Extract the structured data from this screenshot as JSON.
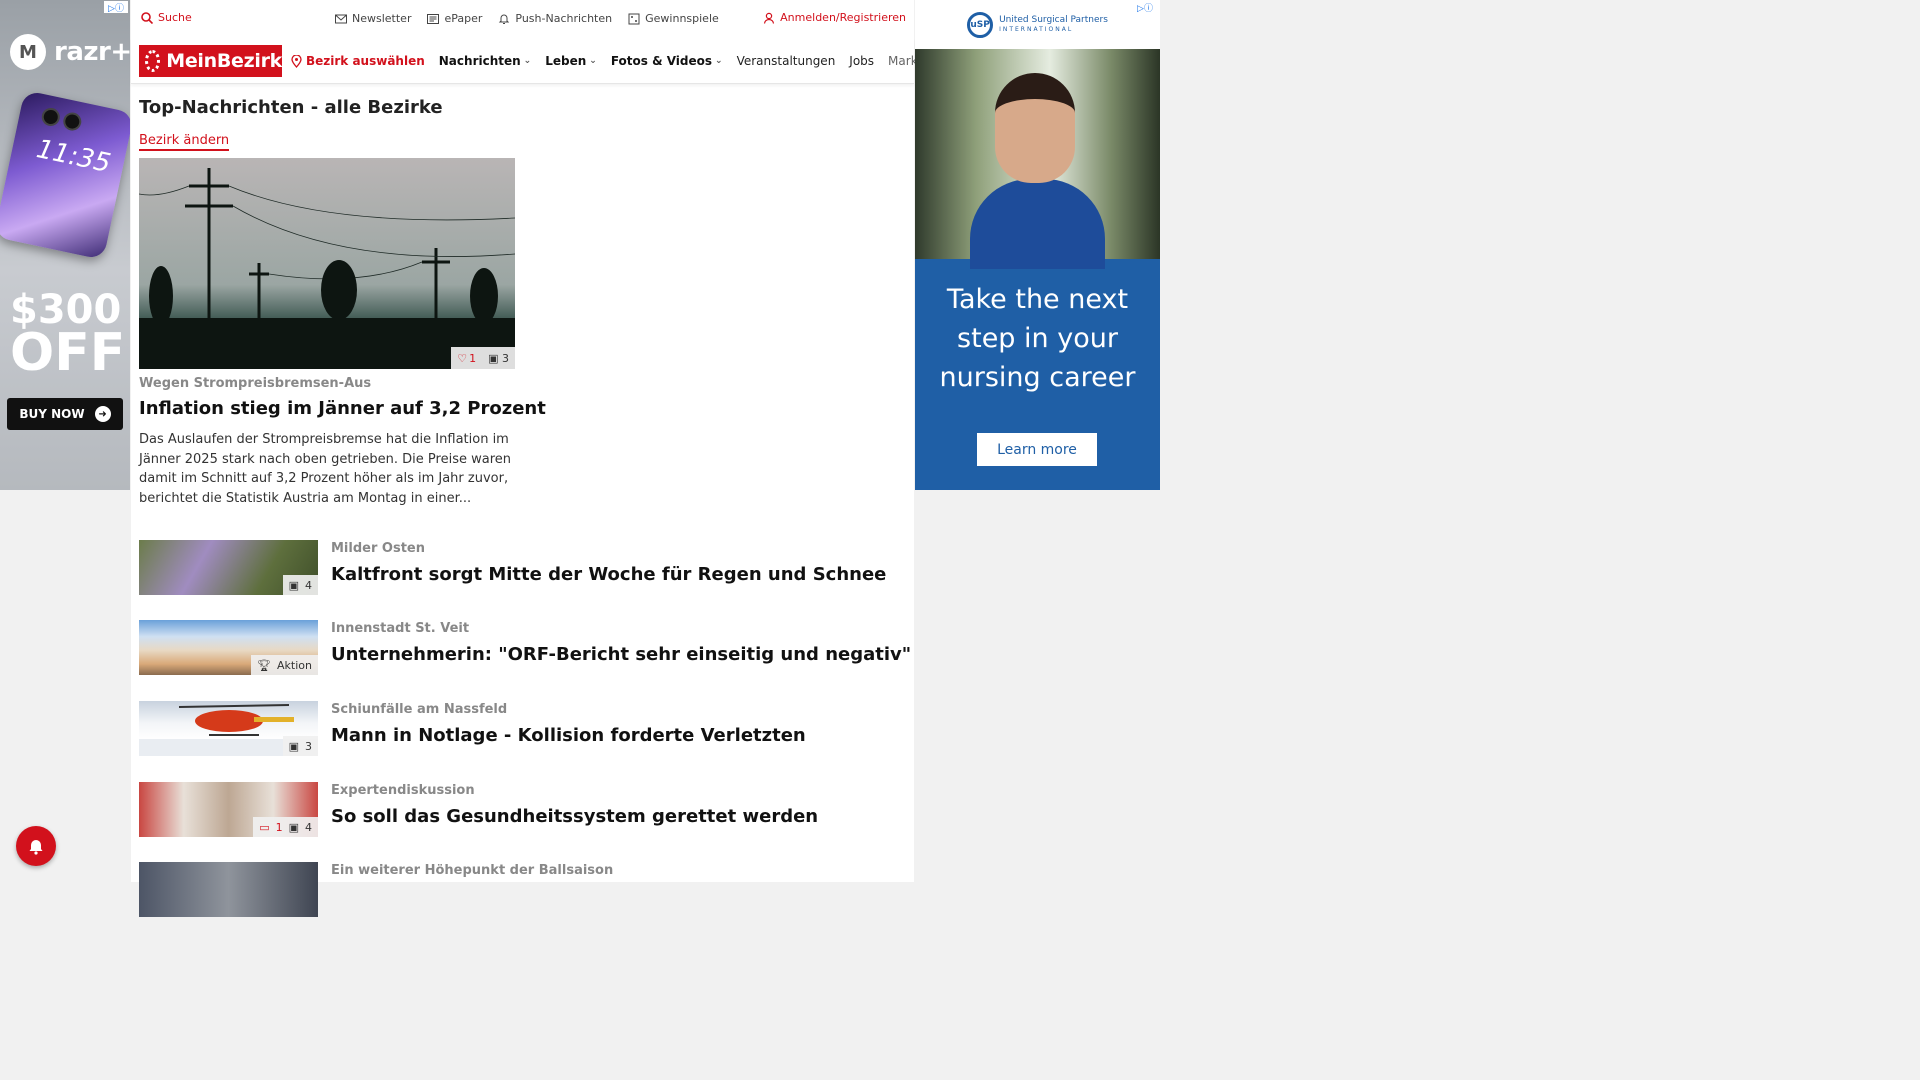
{
  "left_ad": {
    "brand": "razr+",
    "phone_time": "11:35",
    "price": "$300",
    "off": "OFF",
    "cta": "BUY NOW"
  },
  "topbar": {
    "search": "Suche",
    "links": [
      "Newsletter",
      "ePaper",
      "Push-Nachrichten",
      "Gewinnspiele"
    ],
    "login": "Anmelden/Registrieren"
  },
  "navbar": {
    "logo": "MeinBezirk",
    "bezirk": "Bezirk auswählen",
    "items": [
      "Nachrichten",
      "Leben",
      "Fotos & Videos",
      "Veranstaltungen",
      "Jobs",
      "Marktplatz"
    ]
  },
  "section": {
    "title": "Top-Nachrichten - alle Bezirke",
    "change_link": "Bezirk ändern"
  },
  "hero": {
    "likes": "1",
    "images": "3",
    "kicker": "Wegen Strompreisbremsen-Aus",
    "title": "Inflation stieg im Jänner auf 3,2 Prozent",
    "teaser": "Das Auslaufen der Strompreisbremse hat die Inflation im Jänner 2025 stark nach oben getrieben. Die Preise waren damit im Schnitt auf 3,2 Prozent höher als im Jahr zuvor, berichtet die Statistik Austria am Montag in einer..."
  },
  "articles": [
    {
      "kicker": "Milder Osten",
      "title": "Kaltfront sorgt Mitte der Woche für Regen und Schnee",
      "badge_images": "4",
      "badge_comments": "",
      "badge_text": ""
    },
    {
      "kicker": "Innenstadt St. Veit",
      "title": "Unternehmerin: \"ORF-Bericht sehr einseitig und negativ\"",
      "badge_images": "",
      "badge_comments": "",
      "badge_text": "Aktion"
    },
    {
      "kicker": "Schiunfälle am Nassfeld",
      "title": "Mann in Notlage - Kollision forderte Verletzten",
      "badge_images": "3",
      "badge_comments": "",
      "badge_text": ""
    },
    {
      "kicker": "Expertendiskussion",
      "title": "So soll das Gesundheitssystem gerettet werden",
      "badge_images": "4",
      "badge_comments": "1",
      "badge_text": ""
    },
    {
      "kicker": "Ein weiterer Höhepunkt der Ballsaison",
      "title": "",
      "badge_images": "",
      "badge_comments": "",
      "badge_text": ""
    }
  ],
  "right_ad": {
    "company_line1": "United Surgical Partners",
    "company_line2": "INTERNATIONAL",
    "headline_1": "Take the next",
    "headline_2": "step in your",
    "headline_3": "nursing career",
    "cta": "Learn more"
  },
  "colors": {
    "brand_red": "#d2111c",
    "ad_blue": "#1f5fa6"
  }
}
